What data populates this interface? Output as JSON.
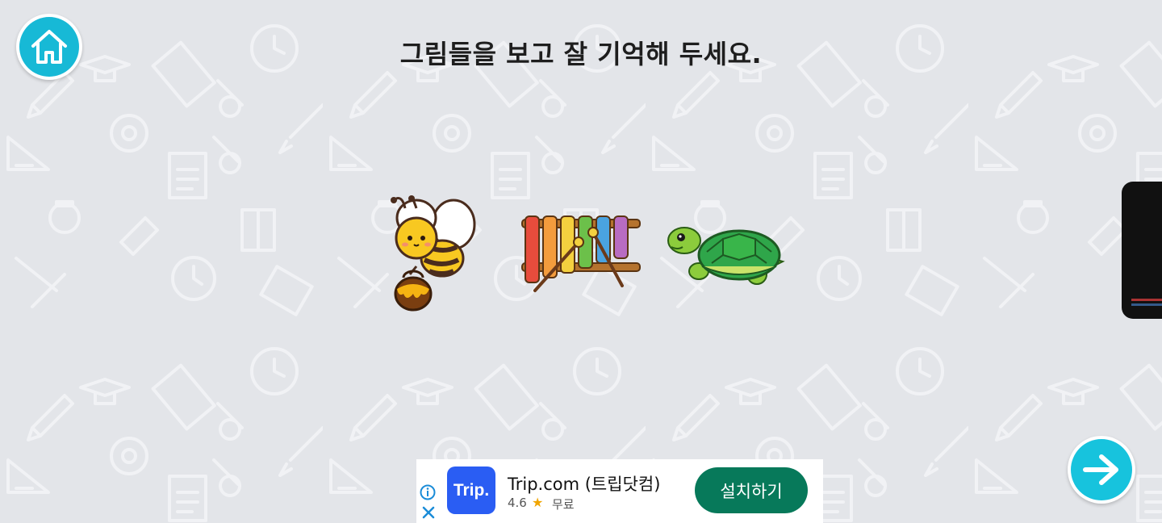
{
  "title": "그림들을 보고 잘 기억해 두세요.",
  "icons": {
    "home": "home-icon",
    "next": "arrow-right-icon",
    "ad_info": "info-icon",
    "ad_close": "close-icon",
    "star": "star-icon"
  },
  "colors": {
    "background": "#e3e5e9",
    "accent": "#17b9d6",
    "install_button": "#07795a",
    "ad_logo": "#2a5df3"
  },
  "memory_items": [
    {
      "name": "bee",
      "label": "bee with honey pot"
    },
    {
      "name": "xylophone",
      "label": "xylophone"
    },
    {
      "name": "turtle",
      "label": "turtle"
    }
  ],
  "ad": {
    "logo_text": "Trip.",
    "app_name": "Trip.com (트립닷컴)",
    "rating": "4.6",
    "star": "★",
    "price": "무료",
    "install_label": "설치하기"
  }
}
